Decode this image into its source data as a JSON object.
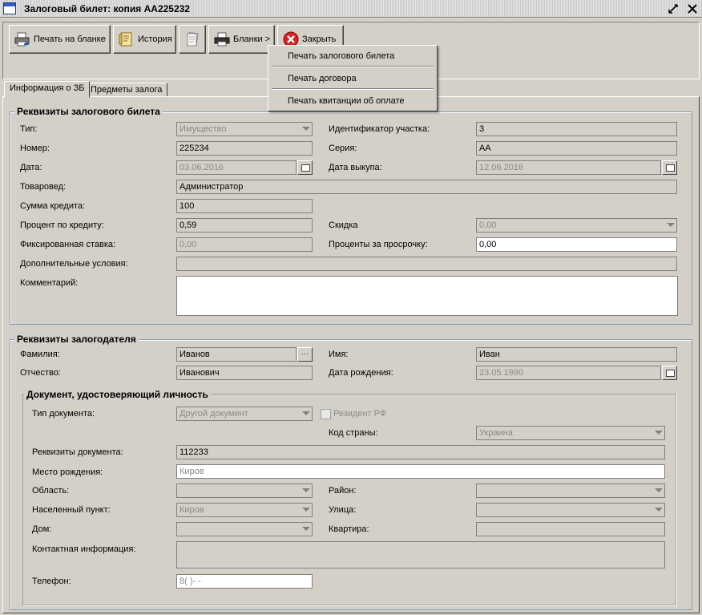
{
  "window": {
    "title": "Залоговый билет:  копия АА225232"
  },
  "toolbar": {
    "print_blank": "Печать на бланке",
    "history": "История",
    "blanks": "Бланки >",
    "close": "Закрыть"
  },
  "dropdown": {
    "items": [
      "Печать залогового билета",
      "Печать договора",
      "Печать квитанции об оплате"
    ]
  },
  "tabs": [
    "Информация о ЗБ",
    "Предметы залога"
  ],
  "ticket": {
    "title": "Реквизиты залогового билета",
    "type_label": "Тип:",
    "type_value": "Имущество",
    "site_id_label": "Идентификатор участка:",
    "site_id_value": "3",
    "number_label": "Номер:",
    "number_value": "225234",
    "series_label": "Серия:",
    "series_value": "АА",
    "date_label": "Дата:",
    "date_value": "03.06.2016",
    "buyout_label": "Дата выкупа:",
    "buyout_value": "12.06.2016",
    "appraiser_label": "Товаровед:",
    "appraiser_value": "Администратор",
    "credit_label": "Сумма кредита:",
    "credit_value": "100",
    "percent_label": "Процент по кредиту:",
    "percent_value": "0,59",
    "discount_label": "Скидка",
    "discount_value": "0,00",
    "fixed_label": "Фиксированная ставка:",
    "fixed_value": "0,00",
    "overdue_label": "Проценты за просрочку:",
    "overdue_value": "0,00",
    "extra_label": "Дополнительные условия:",
    "extra_value": "",
    "comment_label": "Комментарий:",
    "comment_value": ""
  },
  "pledger": {
    "title": "Реквизиты залогодателя",
    "surname_label": "Фамилия:",
    "surname_value": "Иванов",
    "name_label": "Имя:",
    "name_value": "Иван",
    "patronymic_label": "Отчество:",
    "patronymic_value": "Иванович",
    "birth_label": "Дата рождения:",
    "birth_value": "23.05.1990"
  },
  "document": {
    "title": "Документ, удостоверяющий личность",
    "doc_type_label": "Тип документа:",
    "doc_type_value": "Другой документ",
    "resident_label": "Резидент РФ",
    "country_label": "Код страны:",
    "country_value": "Украина",
    "details_label": "Реквизиты документа:",
    "details_value": "112233",
    "birthplace_label": "Место рождения:",
    "birthplace_value": "Киров",
    "region_label": "Область:",
    "region_value": "",
    "district_label": "Район:",
    "district_value": "",
    "locality_label": "Населенный пункт:",
    "locality_value": "Киров",
    "street_label": "Улица:",
    "street_value": "",
    "house_label": "Дом:",
    "house_value": "",
    "apartment_label": "Квартира:",
    "apartment_value": "",
    "contact_label": "Контактная информация:",
    "contact_value": "",
    "phone_label": "Телефон:",
    "phone_value": "8(   )-   -"
  }
}
